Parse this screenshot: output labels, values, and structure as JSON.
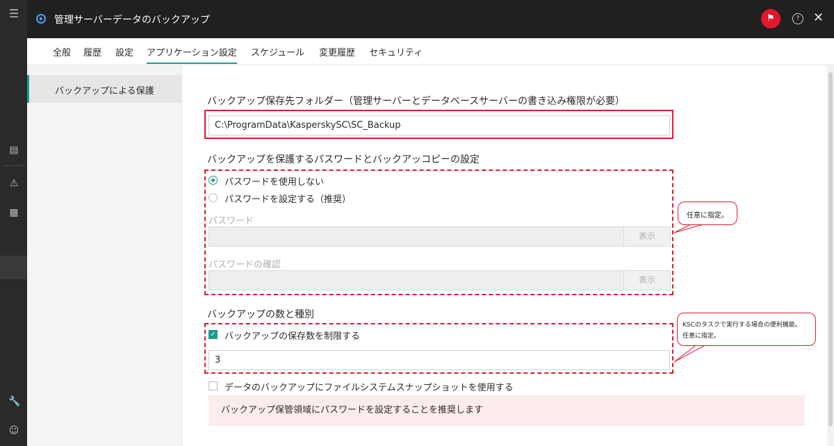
{
  "header": {
    "title": "管理サーバーデータのバックアップ"
  },
  "tabs": [
    "全般",
    "履歴",
    "設定",
    "アプリケーション設定",
    "スケジュール",
    "変更履歴",
    "セキュリティ"
  ],
  "sidebar": {
    "items": [
      {
        "label": "バックアップによる保護"
      }
    ]
  },
  "backup_folder": {
    "heading": "バックアップ保存先フォルダー（管理サーバーとデータベースサーバーの書き込み権限が必要）",
    "value": "C:\\ProgramData\\KasperskySC\\SC_Backup"
  },
  "password_section": {
    "heading": "バックアップを保護するパスワードとバックアッコピーの設定",
    "option_none": "パスワードを使用しない",
    "option_set": "パスワードを設定する（推奨）",
    "selected": "option_none",
    "password_label": "パスワード",
    "confirm_label": "パスワードの確認",
    "show_label": "表示"
  },
  "count_section": {
    "heading": "バックアップの数と種別",
    "limit_label": "バックアップの保存数を制限する",
    "limit_checked": true,
    "limit_value": "3",
    "snapshot_label": "データのバックアップにファイルシステムスナップショットを使用する",
    "snapshot_checked": false
  },
  "warning": {
    "text": "バックアップ保管領域にパスワードを設定することを推奨します"
  },
  "callouts": {
    "first": "任意に指定。",
    "second_line1": "KSCのタスクで実行する場合の便利機能。",
    "second_line2": "任意に指定。"
  },
  "colors": {
    "accent": "#1a9c8d",
    "annotation": "#e0192b",
    "warning_bg": "#fdecec"
  },
  "icons": [
    "menu-icon",
    "server-icon",
    "alert-icon",
    "tree-icon",
    "wrench-icon",
    "user-icon",
    "play-icon",
    "flag-icon",
    "help-icon",
    "close-icon"
  ]
}
